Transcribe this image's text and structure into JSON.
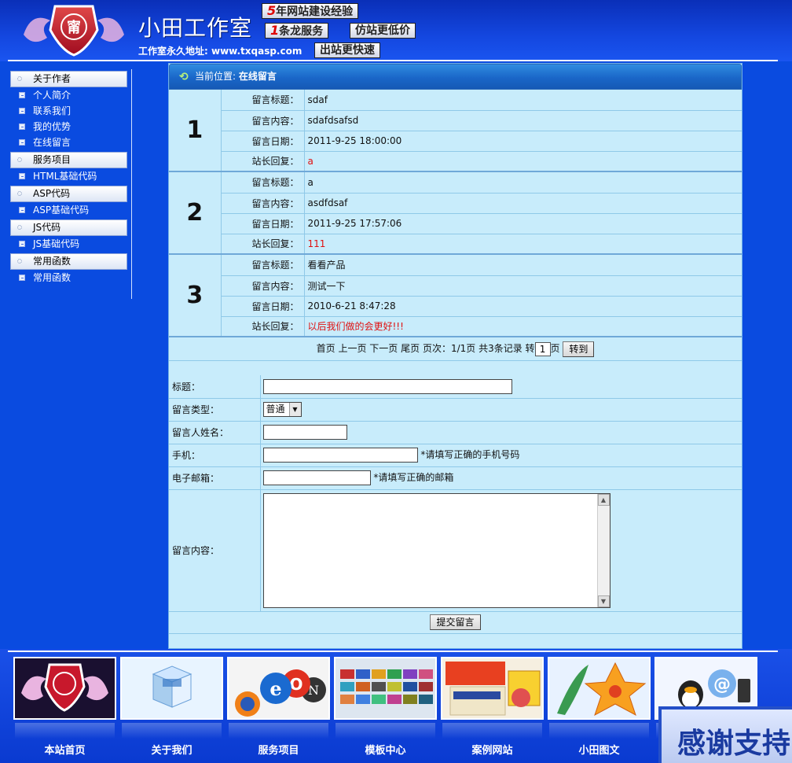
{
  "header": {
    "brand": "小田工作室",
    "tags": [
      {
        "num": "5",
        "text": "年网站建设经验"
      },
      {
        "num": "1",
        "text": "条龙服务"
      },
      {
        "num": "",
        "text": "仿站更低价"
      },
      {
        "num": "",
        "text": "出站更快速"
      }
    ],
    "address": "工作室永久地址: www.txqasp.com"
  },
  "sidebar": [
    {
      "category": "关于作者",
      "items": [
        "个人简介",
        "联系我们",
        "我的优势",
        "在线留言"
      ]
    },
    {
      "category": "服务项目",
      "items": [
        "HTML基础代码"
      ]
    },
    {
      "category": "ASP代码",
      "items": [
        "ASP基础代码"
      ]
    },
    {
      "category": "JS代码",
      "items": [
        "JS基础代码"
      ]
    },
    {
      "category": "常用函数",
      "items": [
        "常用函数"
      ]
    }
  ],
  "breadcrumb": {
    "prefix": "当前位置:",
    "current": "在线留言"
  },
  "field_labels": {
    "title": "留言标题：",
    "content": "留言内容：",
    "date": "留言日期：",
    "reply": "站长回复："
  },
  "messages": [
    {
      "num": "1",
      "title": "sdaf",
      "content": "sdafdsafsd",
      "date": "2011-9-25 18:00:00",
      "reply": "a"
    },
    {
      "num": "2",
      "title": "a",
      "content": "asdfdsaf",
      "date": "2011-9-25 17:57:06",
      "reply": "111"
    },
    {
      "num": "3",
      "title": "看看产品",
      "content": "测试一下",
      "date": "2010-6-21 8:47:28",
      "reply": "以后我们做的会更好!!!"
    }
  ],
  "pager": {
    "first": "首页",
    "prev": "上一页",
    "next": "下一页",
    "last": "尾页",
    "info": "页次：1/1页 共3条记录 转",
    "page_value": "1",
    "page_unit": "页",
    "go": "转到"
  },
  "form": {
    "title_label": "标题：",
    "type_label": "留言类型：",
    "type_value": "普通",
    "name_label": "留言人姓名：",
    "phone_label": "手机：",
    "phone_hint": "*请填写正确的手机号码",
    "email_label": "电子邮箱：",
    "email_hint": "*请填写正确的邮箱",
    "content_label": "留言内容：",
    "submit": "提交留言"
  },
  "footer": [
    "本站首页",
    "关于我们",
    "服务项目",
    "模板中心",
    "案例网站",
    "小田图文"
  ],
  "thanks": "感谢支持"
}
